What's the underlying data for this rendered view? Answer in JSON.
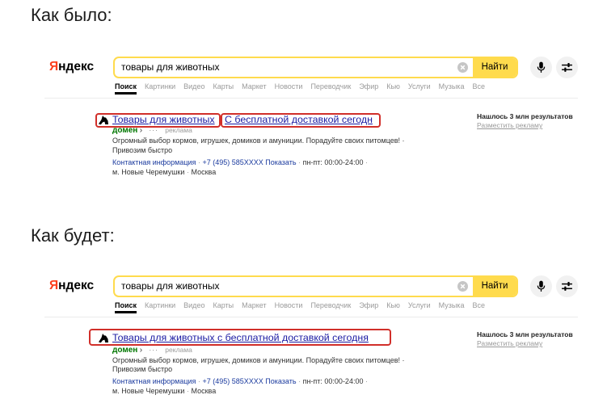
{
  "colors": {
    "brand_yellow": "#ffdb4d",
    "logo_red": "#fc3f1d",
    "domain_green": "#007700",
    "title_blue": "#1b1ba3",
    "link_blue": "#1a3a9e",
    "highlight_red": "#d12f2a"
  },
  "icons": {
    "favicon": "dog-favicon-icon",
    "clear": "clear-icon",
    "voice": "microphone-icon",
    "settings": "sliders-icon"
  },
  "before": {
    "heading": "Как было:",
    "header": {
      "logo": "Яндекс",
      "search_query": "товары для животных",
      "search_button": "Найти",
      "tabs": [
        "Поиск",
        "Картинки",
        "Видео",
        "Карты",
        "Маркет",
        "Новости",
        "Переводчик",
        "Эфир",
        "Кью",
        "Услуги",
        "Музыка",
        "Все"
      ]
    },
    "ad": {
      "title": [
        "Товары для животных",
        "С бесплатной доставкой сегодн"
      ],
      "domain": "домен",
      "arrow": "›",
      "more": "···",
      "label": "реклама",
      "text": "Огромный выбор кормов, игрушек, домиков и амуниции. Порадуйте своих питомцев! ·",
      "text2": "Привозим быстро",
      "contacts": "Контактная информация",
      "phone": "+7 (495) 585XXXX",
      "phone_action": "Показать",
      "hours": "пн-пт: 00:00-24:00",
      "metro": "м. Новые Черемушки",
      "city": "Москва",
      "sep": "·"
    },
    "aside": {
      "found": "Нашлось 3 млн результатов",
      "place_ad": "Разместить рекламу"
    }
  },
  "after": {
    "heading": "Как будет:",
    "header": {
      "logo": "Яндекс",
      "search_query": "товары для животных",
      "search_button": "Найти",
      "tabs": [
        "Поиск",
        "Картинки",
        "Видео",
        "Карты",
        "Маркет",
        "Новости",
        "Переводчик",
        "Эфир",
        "Кью",
        "Услуги",
        "Музыка",
        "Все"
      ]
    },
    "ad": {
      "title": "Товары для животных с бесплатной доставкой сегодня",
      "domain": "домен",
      "arrow": "›",
      "more": "···",
      "label": "реклама",
      "text": "Огромный выбор кормов, игрушек, домиков и амуниции. Порадуйте своих питомцев! ·",
      "text2": "Привозим быстро",
      "contacts": "Контактная информация",
      "phone": "+7 (495) 585XXXX",
      "phone_action": "Показать",
      "hours": "пн-пт: 00:00-24:00",
      "metro": "м. Новые Черемушки",
      "city": "Москва",
      "sep": "·"
    },
    "aside": {
      "found": "Нашлось 3 млн результатов",
      "place_ad": "Разместить рекламу"
    }
  }
}
